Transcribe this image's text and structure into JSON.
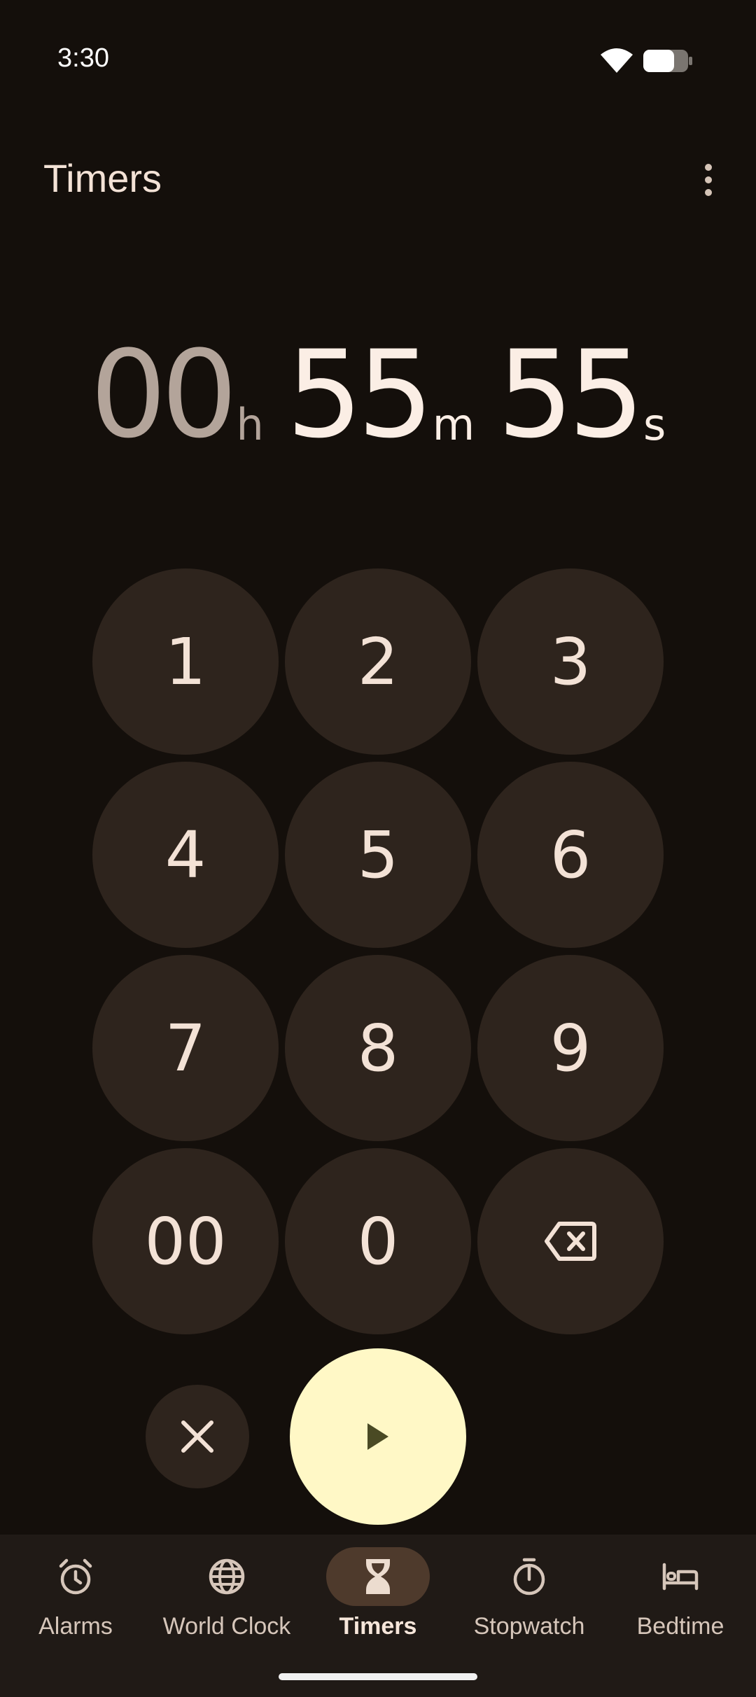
{
  "status_bar": {
    "time": "3:30"
  },
  "app_bar": {
    "title": "Timers"
  },
  "timer": {
    "hours": "00",
    "hours_unit": "h",
    "minutes": "55",
    "minutes_unit": "m",
    "seconds": "55",
    "seconds_unit": "s"
  },
  "keypad": {
    "keys": [
      "1",
      "2",
      "3",
      "4",
      "5",
      "6",
      "7",
      "8",
      "9",
      "00",
      "0"
    ],
    "backspace_icon": "backspace-icon"
  },
  "controls": {
    "clear_icon": "close-icon",
    "start_icon": "play-icon"
  },
  "nav": {
    "items": [
      {
        "label": "Alarms",
        "icon": "alarm-icon",
        "active": false
      },
      {
        "label": "World Clock",
        "icon": "globe-icon",
        "active": false
      },
      {
        "label": "Timers",
        "icon": "hourglass-icon",
        "active": true
      },
      {
        "label": "Stopwatch",
        "icon": "stopwatch-icon",
        "active": false
      },
      {
        "label": "Bedtime",
        "icon": "bed-icon",
        "active": false
      }
    ]
  },
  "colors": {
    "background": "#140f0b",
    "key": "#2e241d",
    "start": "#fff8c6",
    "nav": "#201a16",
    "nav_active": "#4e3a2c"
  }
}
